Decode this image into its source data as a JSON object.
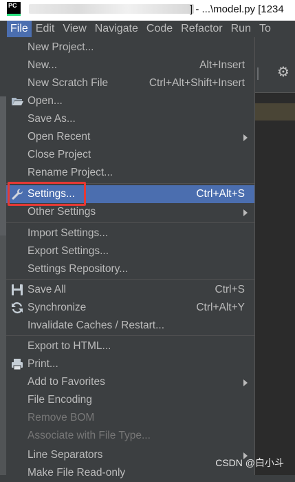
{
  "titlebar": {
    "logo": "PC",
    "title": "] - ...\\model.py [1234"
  },
  "menubar": {
    "items": [
      {
        "label": "File",
        "active": true
      },
      {
        "label": "Edit"
      },
      {
        "label": "View"
      },
      {
        "label": "Navigate"
      },
      {
        "label": "Code"
      },
      {
        "label": "Refactor"
      },
      {
        "label": "Run"
      },
      {
        "label": "To"
      }
    ]
  },
  "file_menu": {
    "items": [
      {
        "label": "New Project...",
        "shortcut": ""
      },
      {
        "label": "New...",
        "shortcut": "Alt+Insert"
      },
      {
        "label": "New Scratch File",
        "shortcut": "Ctrl+Alt+Shift+Insert"
      },
      {
        "label": "Open...",
        "shortcut": "",
        "icon": "folder-open-icon"
      },
      {
        "label": "Save As...",
        "shortcut": ""
      },
      {
        "label": "Open Recent",
        "shortcut": "",
        "submenu": true
      },
      {
        "label": "Close Project",
        "shortcut": ""
      },
      {
        "label": "Rename Project...",
        "shortcut": ""
      },
      {
        "label": "Settings...",
        "shortcut": "Ctrl+Alt+S",
        "icon": "wrench-icon",
        "selected": true
      },
      {
        "label": "Other Settings",
        "shortcut": "",
        "submenu": true
      },
      {
        "label": "Import Settings...",
        "shortcut": ""
      },
      {
        "label": "Export Settings...",
        "shortcut": ""
      },
      {
        "label": "Settings Repository...",
        "shortcut": ""
      },
      {
        "label": "Save All",
        "shortcut": "Ctrl+S",
        "icon": "save-all-icon"
      },
      {
        "label": "Synchronize",
        "shortcut": "Ctrl+Alt+Y",
        "icon": "sync-icon"
      },
      {
        "label": "Invalidate Caches / Restart...",
        "shortcut": ""
      },
      {
        "label": "Export to HTML...",
        "shortcut": ""
      },
      {
        "label": "Print...",
        "shortcut": "",
        "icon": "printer-icon"
      },
      {
        "label": "Add to Favorites",
        "shortcut": "",
        "submenu": true
      },
      {
        "label": "File Encoding",
        "shortcut": ""
      },
      {
        "label": "Remove BOM",
        "shortcut": "",
        "disabled": true
      },
      {
        "label": "Associate with File Type...",
        "shortcut": "",
        "disabled": true
      },
      {
        "label": "Line Separators",
        "shortcut": "",
        "submenu": true
      },
      {
        "label": "Make File Read-only",
        "shortcut": ""
      }
    ]
  },
  "watermark": "CSDN @白小斗",
  "colors": {
    "menu_bg": "#3c3f41",
    "selection": "#4b6eaf",
    "text": "#bbbbbb",
    "disabled_text": "#777777",
    "annotation_red": "#e53935"
  }
}
